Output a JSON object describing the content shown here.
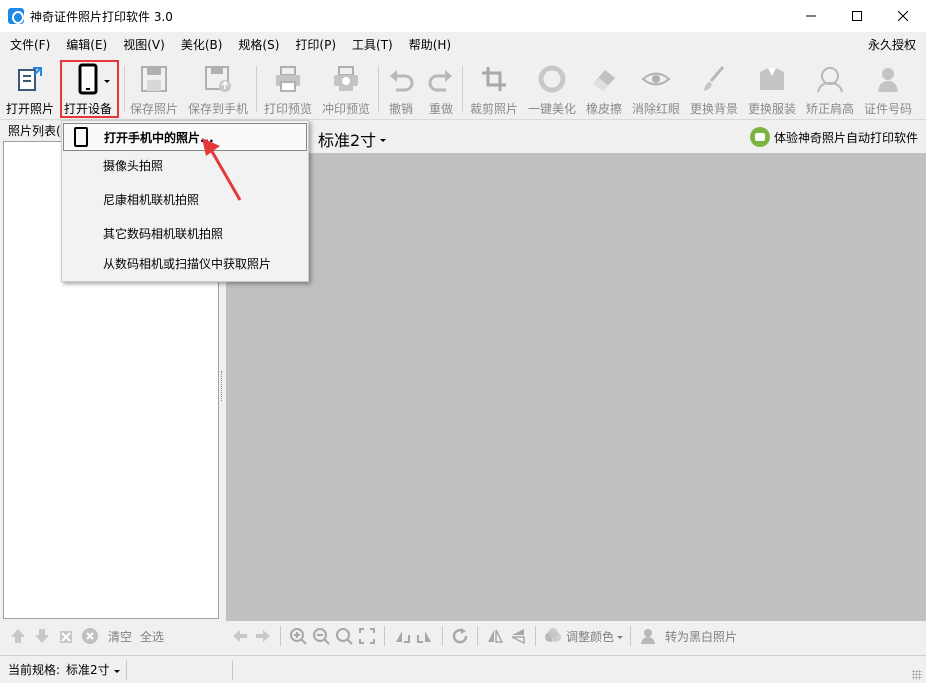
{
  "window": {
    "title": "神奇证件照片打印软件 3.0"
  },
  "menu": {
    "items": [
      "文件(F)",
      "编辑(E)",
      "视图(V)",
      "美化(B)",
      "规格(S)",
      "打印(P)",
      "工具(T)",
      "帮助(H)"
    ],
    "license": "永久授权"
  },
  "toolbar": {
    "open_photo": "打开照片",
    "open_device": "打开设备",
    "save_photo": "保存照片",
    "save_to_phone": "保存到手机",
    "print_preview": "打印预览",
    "develop_preview": "冲印预览",
    "undo": "撤销",
    "redo": "重做",
    "crop": "裁剪照片",
    "one_click_beautify": "一键美化",
    "eraser": "橡皮擦",
    "remove_redeye": "消除红眼",
    "change_background": "更换背景",
    "change_clothes": "更换服装",
    "fix_shoulders": "矫正肩高",
    "id_number": "证件号码"
  },
  "left_panel": {
    "header": "照片列表(",
    "clear": "清空",
    "select_all": "全选"
  },
  "main": {
    "size_label": "标准2寸",
    "promo": "体验神奇照片自动打印软件"
  },
  "bottom_toolbar": {
    "adjust_color": "调整颜色",
    "to_bw": "转为黑白照片"
  },
  "status": {
    "label": "当前规格:",
    "value": "标准2寸"
  },
  "device_menu": {
    "items": [
      "打开手机中的照片...",
      "摄像头拍照",
      "尼康相机联机拍照",
      "其它数码相机联机拍照",
      "从数码相机或扫描仪中获取照片"
    ]
  },
  "colors": {
    "highlight_border": "#e5383b",
    "canvas_bg": "#c0c0c0",
    "accent": "#1e88e5"
  }
}
